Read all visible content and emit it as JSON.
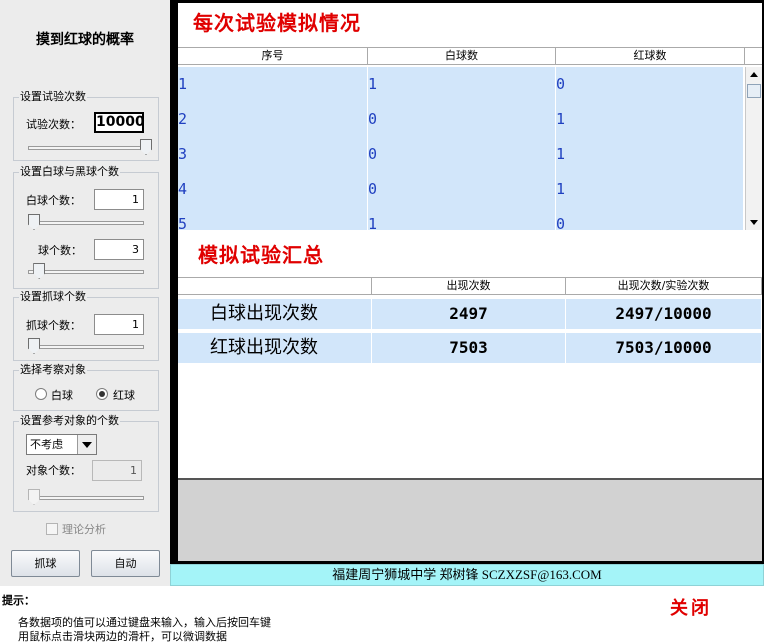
{
  "app": {
    "title": "摸到红球的概率"
  },
  "settings": {
    "trials": {
      "group_label": "设置试验次数",
      "label": "试验次数：",
      "value": "10000",
      "slider_fraction": 1.0
    },
    "balls": {
      "group_label": "设置白球与黑球个数",
      "white_label": "白球个数：",
      "white_value": "1",
      "white_slider_fraction": 0.0,
      "black_label": "球个数：",
      "black_value": "3",
      "black_slider_fraction": 0.05
    },
    "draw": {
      "group_label": "设置抓球个数",
      "label": "抓球个数：",
      "value": "1",
      "slider_fraction": 0.0
    },
    "target": {
      "group_label": "选择考察对象",
      "options": [
        "白球",
        "红球"
      ],
      "selected": 1
    },
    "reference": {
      "group_label": "设置参考对象的个数",
      "select_value": "不考虑",
      "label": "对象个数：",
      "value": "1",
      "slider_fraction": 0.0
    },
    "theory_label": "理论分析",
    "draw_button": "抓球",
    "auto_button": "自动"
  },
  "simulation": {
    "title": "每次试验模拟情况",
    "columns": [
      "序号",
      "白球数",
      "红球数"
    ],
    "rows": [
      [
        "1",
        "1",
        "0"
      ],
      [
        "2",
        "0",
        "1"
      ],
      [
        "3",
        "0",
        "1"
      ],
      [
        "4",
        "0",
        "1"
      ],
      [
        "5",
        "1",
        "0"
      ]
    ]
  },
  "summary": {
    "title": "模拟试验汇总",
    "columns": [
      "",
      "出现次数",
      "出现次数/实验次数"
    ],
    "rows": [
      [
        "白球出现次数",
        "2497",
        "2497/10000"
      ],
      [
        "红球出现次数",
        "7503",
        "7503/10000"
      ]
    ]
  },
  "footer": {
    "credit": "福建周宁狮城中学   郑树锋   SCZXZSF@163.COM"
  },
  "tips": {
    "title": "提示：",
    "lines": [
      "各数据项的值可以通过键盘来输入，输入后按回车键",
      "用鼠标点击滑块两边的滑杆，可以微调数据"
    ],
    "close_label": "关闭"
  },
  "colors": {
    "accent_red": "#e00000",
    "row_shade": "#d2e6fa",
    "footer_bg": "#a4f4f8",
    "table_text": "#2040c0"
  }
}
